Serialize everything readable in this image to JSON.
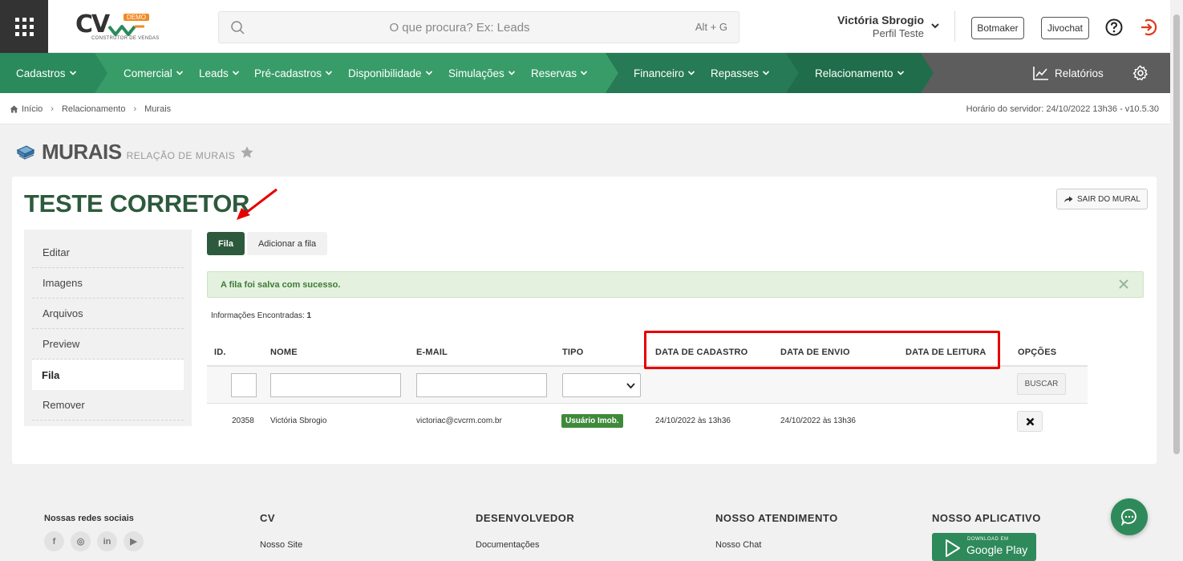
{
  "header": {
    "logo_text": "CV",
    "logo_badge": "DEMO",
    "logo_subtitle": "CONSTRUTOR DE VENDAS",
    "search_placeholder": "O que procura? Ex: Leads",
    "search_shortcut": "Alt + G",
    "user_name": "Victória Sbrogio",
    "user_profile": "Perfil Teste",
    "buttons": [
      "Botmaker",
      "Jivochat"
    ]
  },
  "nav": {
    "items": [
      "Cadastros",
      "Comercial",
      "Leads",
      "Pré-cadastros",
      "Disponibilidade",
      "Simulações",
      "Reservas",
      "Financeiro",
      "Repasses",
      "Relacionamento"
    ],
    "reports": "Relatórios",
    "colors": {
      "green_1": "#2a8a5c",
      "green_2": "#389c68",
      "green_3": "#267a55",
      "green_4": "#1f6d4b",
      "gray": "#5d5d5d"
    }
  },
  "breadcrumb": {
    "items": [
      "Início",
      "Relacionamento",
      "Murais"
    ],
    "server_time": "Horário do servidor: 24/10/2022 13h36 - v10.5.30"
  },
  "page": {
    "title": "MURAIS",
    "subtitle": "RELAÇÃO DE MURAIS"
  },
  "mural": {
    "title": "TESTE CORRETOR",
    "exit_label": "SAIR DO MURAL",
    "side_menu": [
      "Editar",
      "Imagens",
      "Arquivos",
      "Preview",
      "Fila",
      "Remover"
    ],
    "active_side": "Fila",
    "tabs": [
      "Fila",
      "Adicionar a fila"
    ],
    "alert": "A fila foi salva com sucesso.",
    "found_label": "Informações Encontradas:",
    "found_count": "1",
    "columns": [
      "ID.",
      "NOME",
      "E-MAIL",
      "TIPO",
      "DATA DE CADASTRO",
      "DATA DE ENVIO",
      "DATA DE LEITURA",
      "OPÇÕES"
    ],
    "search_button": "BUSCAR",
    "rows": [
      {
        "id": "20358",
        "nome": "Victória Sbrogio",
        "email": "victoriac@cvcrm.com.br",
        "tipo": "Usuário Imob.",
        "data_cadastro": "24/10/2022 às 13h36",
        "data_envio": "24/10/2022 às 13h36",
        "data_leitura": ""
      }
    ]
  },
  "footer": {
    "social_title": "Nossas redes sociais",
    "social_icons": [
      "facebook-icon",
      "instagram-icon",
      "linkedin-icon",
      "youtube-icon"
    ],
    "social_glyphs": [
      "f",
      "◎",
      "in",
      "▶"
    ],
    "columns": [
      {
        "title": "CV",
        "link": "Nosso Site"
      },
      {
        "title": "DESENVOLVEDOR",
        "link": "Documentações"
      },
      {
        "title": "NOSSO ATENDIMENTO",
        "link": "Nosso Chat"
      },
      {
        "title": "NOSSO APLICATIVO"
      }
    ],
    "gplay_top": "DOWNLOAD EM",
    "gplay_big": "Google Play"
  }
}
